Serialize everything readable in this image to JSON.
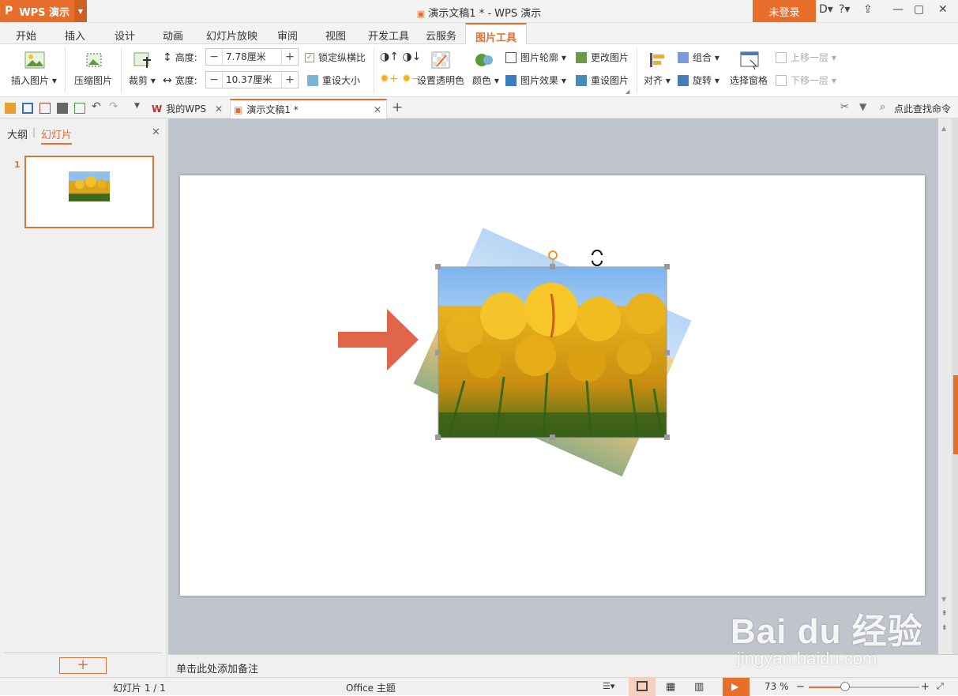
{
  "app": {
    "name": "WPS 演示",
    "title": "演示文稿1 * - WPS 演示",
    "login": "未登录"
  },
  "tabs": [
    "开始",
    "插入",
    "设计",
    "动画",
    "幻灯片放映",
    "审阅",
    "视图",
    "开发工具",
    "云服务",
    "图片工具"
  ],
  "active_tab": "图片工具",
  "ribbon": {
    "insert_picture": "插入图片",
    "compress_picture": "压缩图片",
    "crop": "裁剪",
    "height_label": "高度:",
    "height_value": "7.78厘米",
    "width_label": "宽度:",
    "width_value": "10.37厘米",
    "lock_ratio": "锁定纵横比",
    "lock_ratio_checked": true,
    "reset_size": "重设大小",
    "set_transparent": "设置透明色",
    "color": "颜色",
    "picture_outline": "图片轮廓",
    "picture_effect": "图片效果",
    "change_picture": "更改图片",
    "reset_picture": "重设图片",
    "align": "对齐",
    "group": "组合",
    "rotate": "旋转",
    "selection_pane": "选择窗格",
    "bring_forward": "上移一层",
    "send_backward": "下移一层"
  },
  "doc_tabs": [
    {
      "label": "我的WPS"
    },
    {
      "label": "演示文稿1 *"
    }
  ],
  "search_command": "点此查找命令",
  "left_panel": {
    "tab_outline": "大纲",
    "tab_slides": "幻灯片",
    "slide_number": "1"
  },
  "notes_placeholder": "单击此处添加备注",
  "status": {
    "slide": "幻灯片 1 / 1",
    "theme": "Office 主题",
    "zoom": "73 %",
    "zoom_percent": 73
  },
  "watermark": {
    "brand": "Bai du 经验",
    "url": "jingyan.baidu.com"
  },
  "colors": {
    "accent": "#e86e2c",
    "arrow": "#e0654a"
  }
}
